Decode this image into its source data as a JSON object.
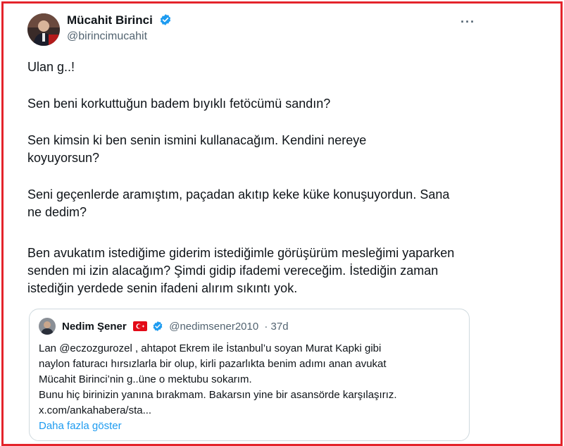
{
  "tweet": {
    "author_name": "Mücahit Birinci",
    "author_handle": "@birincimucahit",
    "more_label": "···",
    "paragraphs": [
      "Ulan g..!",
      "Sen beni korkuttuğun badem bıyıklı fetöcümü sandın?",
      "Sen kimsin ki ben senin ismini kullanacağım. Kendini nereye koyuyorsun?",
      "Seni geçenlerde aramıştım, paçadan akıtıp keke küke konuşuyordun. Sana ne dedim?",
      "Ben avukatım istediğime giderim istediğimle görüşürüm mesleğimi yaparken senden mi izin alacağım? Şimdi gidip ifademi vereceğim. İstediğin zaman istediğin yerdede senin ifadeni alırım sıkıntı yok."
    ]
  },
  "quoted": {
    "author_name": "Nedim Şener",
    "author_handle": "@nedimsener2010",
    "time_ago": "· 37d",
    "lines": [
      "Lan @eczozgurozel , ahtapot Ekrem ile İstanbul’u soyan Murat Kapki gibi",
      "naylon faturacı hırsızlarla bir olup, kirli pazarlıkta benim adımı anan avukat",
      "Mücahit Birinci’nin g..üne o mektubu sokarım.",
      "Bunu hiç birinizin yanına bırakmam. Bakarsın yine bir asansörde karşılaşırız.",
      "x.com/ankahabera/sta..."
    ],
    "show_more": "Daha fazla göster"
  },
  "colors": {
    "frame_border": "#e4242b",
    "text": "#0f1419",
    "secondary": "#536471",
    "link": "#1d9bf0",
    "verified": "#1d9bf0"
  }
}
